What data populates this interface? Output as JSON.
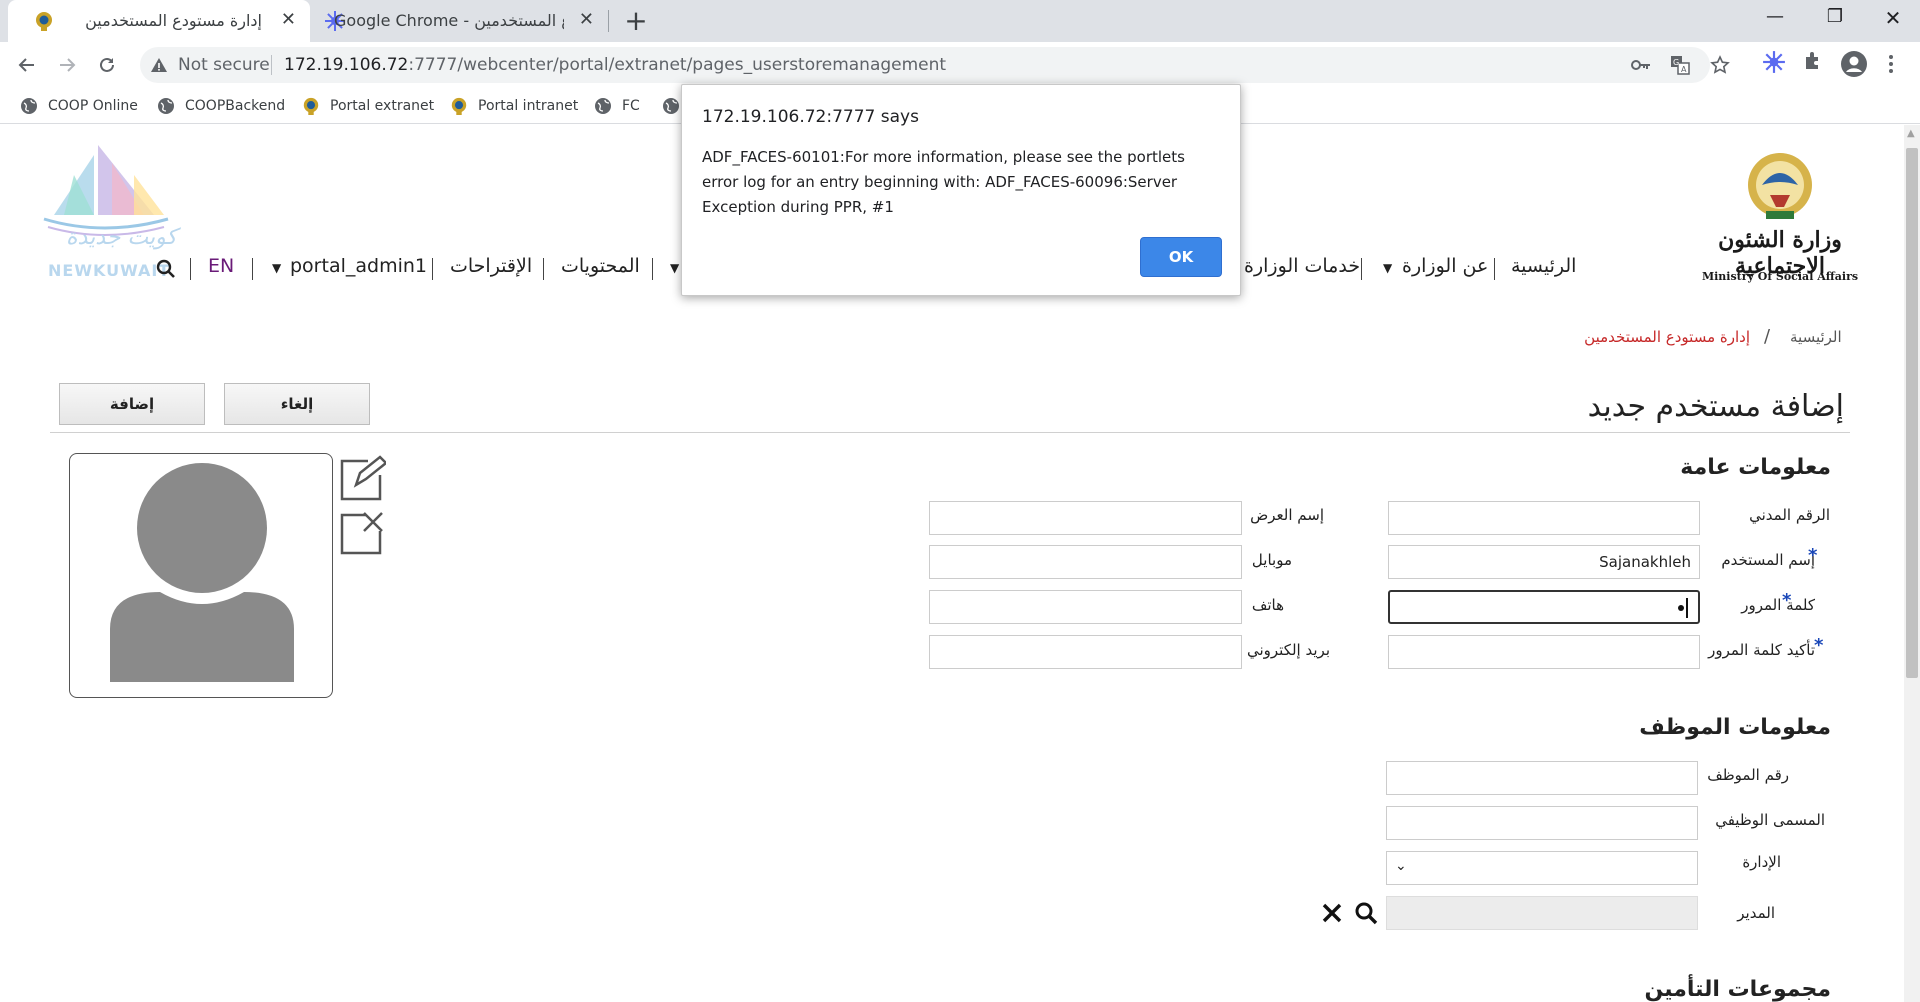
{
  "browser": {
    "tabs": [
      {
        "title": "إدارة مستودع المستخدمين",
        "active": true
      },
      {
        "title": "Google Chrome - ودع المستخدمين",
        "active": false
      }
    ],
    "new_tab": "+",
    "window_controls": {
      "minimize": "—",
      "maximize": "❐",
      "close": "✕"
    },
    "address": {
      "security": "Not secure",
      "host": "172.19.106.72",
      "path": ":7777/webcenter/portal/extranet/pages_userstoremanagement"
    },
    "bookmarks": [
      "COOP Online",
      "COOPBackend",
      "Portal extranet",
      "Portal intranet",
      "FC"
    ]
  },
  "header": {
    "nav": {
      "home": "الرئيسية",
      "about": "عن الوزارة",
      "services": "خدمات الوزارة",
      "contents": "المحتويات",
      "suggestions": "الإقتراحات",
      "user": "portal_admin1",
      "lang": "EN"
    },
    "ministry_en": "Ministry Of Social Affairs",
    "ministry_ar": "وزارة الشئون الاجتماعية",
    "newkuwait_ar": "كويت جديدة",
    "newkuwait_en": "NEWKUWAIT"
  },
  "breadcrumb": {
    "home": "الرئيسية",
    "separator": "/",
    "current": "إدارة مستودع المستخدمين"
  },
  "form": {
    "title": "إضافة مستخدم جديد",
    "add_label": "إضافة",
    "cancel_label": "إلغاء",
    "required_mark": "*",
    "general_section": "معلومات عامة",
    "general_right": [
      {
        "label": "الرقم المدني",
        "value": "",
        "required": false
      },
      {
        "label": "إسم المستخدم",
        "value": "Sajanakhleh",
        "required": true
      },
      {
        "label": "كلمة المرور",
        "value": "",
        "required": true
      },
      {
        "label": "تأكيد كلمة المرور",
        "value": "",
        "required": true
      }
    ],
    "general_left": [
      {
        "label": "إسم العرض",
        "value": ""
      },
      {
        "label": "موبايل",
        "value": ""
      },
      {
        "label": "هاتف",
        "value": ""
      },
      {
        "label": "بريد إلكتروني",
        "value": ""
      }
    ],
    "employee_section": "معلومات الموظف",
    "employee": [
      {
        "label": "رقم الموظف",
        "value": ""
      },
      {
        "label": "المسمى الوظيفي",
        "value": ""
      },
      {
        "label": "الإدارة",
        "value": ""
      },
      {
        "label": "المدير",
        "value": ""
      }
    ],
    "security_section": "مجموعات التأمين"
  },
  "dialog": {
    "title": "172.19.106.72:7777 says",
    "message": "ADF_FACES-60101:For more information, please see the portlets error log for an entry beginning with: ADF_FACES-60096:Server Exception during PPR, #1",
    "ok_label": "OK"
  },
  "colors": {
    "accent": "#3c87e8",
    "breadcrumb_current": "#c62828",
    "lang": "#6a1b78",
    "required": "#1a47b8"
  }
}
